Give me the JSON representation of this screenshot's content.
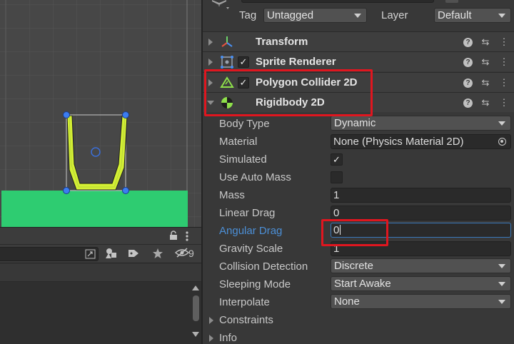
{
  "inspector": {
    "tag_label": "Tag",
    "tag_value": "Untagged",
    "layer_label": "Layer",
    "layer_value": "Default",
    "components": [
      {
        "title": "Transform"
      },
      {
        "title": "Sprite Renderer",
        "enabled": true
      },
      {
        "title": "Polygon Collider 2D",
        "enabled": true
      },
      {
        "title": "Rigidbody 2D"
      }
    ],
    "rigidbody": {
      "body_type": {
        "label": "Body Type",
        "value": "Dynamic"
      },
      "material": {
        "label": "Material",
        "value": "None (Physics Material 2D)"
      },
      "simulated": {
        "label": "Simulated",
        "checked": true
      },
      "use_auto_mass": {
        "label": "Use Auto Mass",
        "checked": false
      },
      "mass": {
        "label": "Mass",
        "value": "1"
      },
      "linear_drag": {
        "label": "Linear Drag",
        "value": "0"
      },
      "angular_drag": {
        "label": "Angular Drag",
        "value": "0"
      },
      "gravity_scale": {
        "label": "Gravity Scale",
        "value": "1"
      },
      "collision_detection": {
        "label": "Collision Detection",
        "value": "Discrete"
      },
      "sleeping_mode": {
        "label": "Sleeping Mode",
        "value": "Start Awake"
      },
      "interpolate": {
        "label": "Interpolate",
        "value": "None"
      },
      "constraints": {
        "label": "Constraints"
      },
      "info": {
        "label": "Info"
      }
    }
  },
  "bottom_panel": {
    "hidden_count": "9"
  },
  "icons": {
    "transform": "transform-axes-icon",
    "sprite_renderer": "sprite-renderer-icon",
    "polygon_collider": "polygon-collider-icon",
    "rigidbody": "rigidbody-icon",
    "help": "help-icon",
    "presets": "presets-sliders-icon",
    "more": "kebab-menu-icon"
  },
  "colors": {
    "ground": "#2ecc71",
    "cup": "#d4f033",
    "highlight_box": "#e0161f",
    "focus_blue": "#4c8fd6"
  }
}
